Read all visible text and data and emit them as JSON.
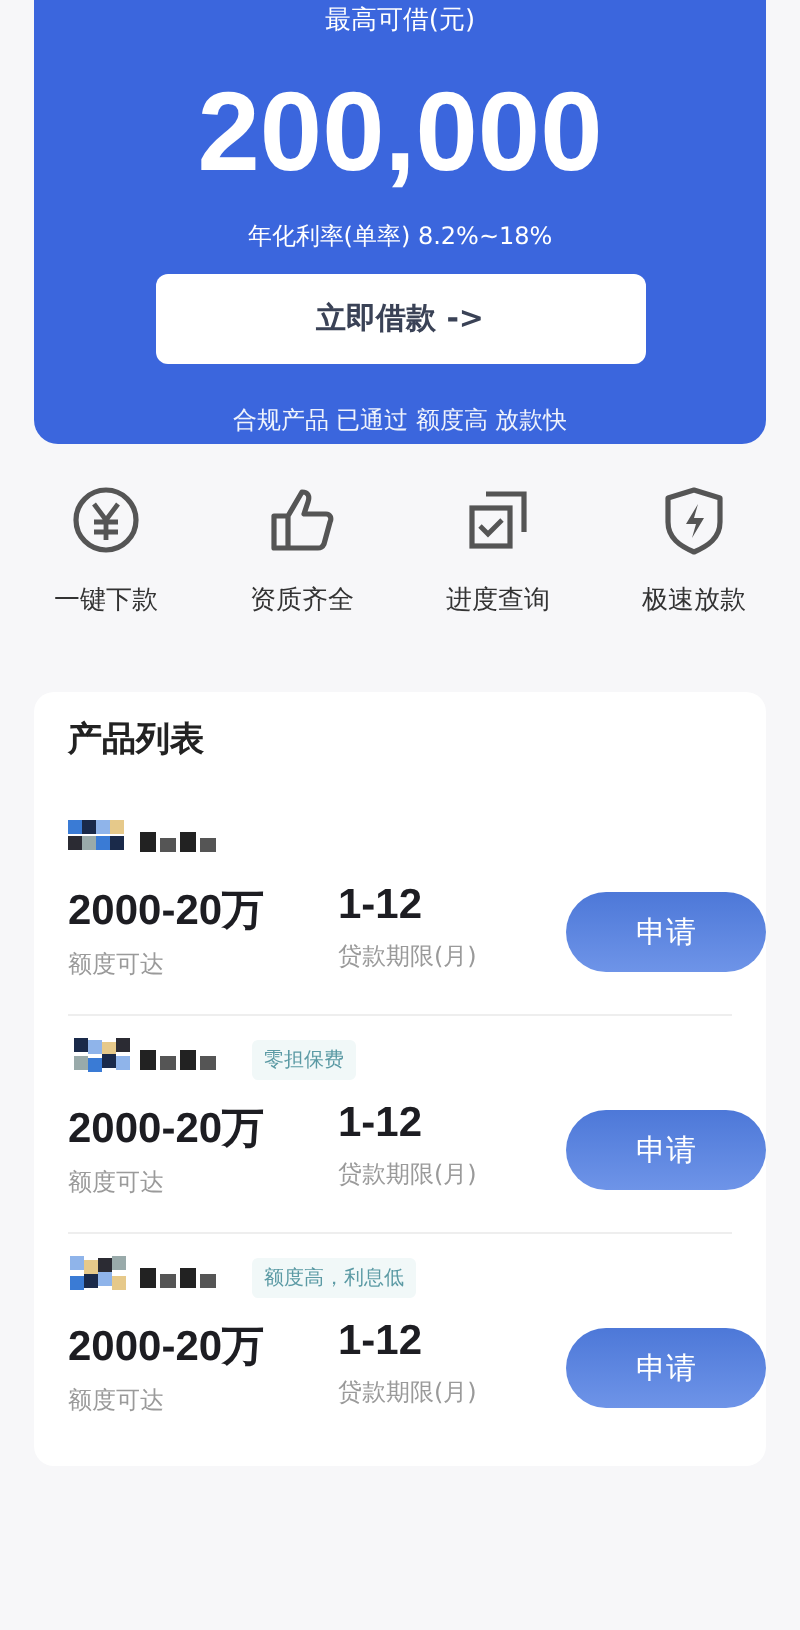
{
  "hero": {
    "caption": "最高可借(元)",
    "amount": "200,000",
    "rate": "年化利率(单率) 8.2%~18%",
    "button": "立即借款 ->",
    "footnote": "合规产品 已通过 额度高 放款快"
  },
  "features": [
    {
      "kind": "yen",
      "label": "一键下款"
    },
    {
      "kind": "thumb",
      "label": "资质齐全"
    },
    {
      "kind": "check",
      "label": "进度查询"
    },
    {
      "kind": "shield",
      "label": "极速放款"
    }
  ],
  "products": {
    "title": "产品列表",
    "items": [
      {
        "amount": "2000-20万",
        "amount_label": "额度可达",
        "term": "1-12",
        "term_label": "贷款期限(月)",
        "button": "申请"
      },
      {
        "tag": "零担保费",
        "amount": "2000-20万",
        "amount_label": "额度可达",
        "term": "1-12",
        "term_label": "贷款期限(月)",
        "button": "申请"
      },
      {
        "tag": "额度高，利息低",
        "amount": "2000-20万",
        "amount_label": "额度可达",
        "term": "1-12",
        "term_label": "贷款期限(月)",
        "button": "申请"
      }
    ]
  }
}
